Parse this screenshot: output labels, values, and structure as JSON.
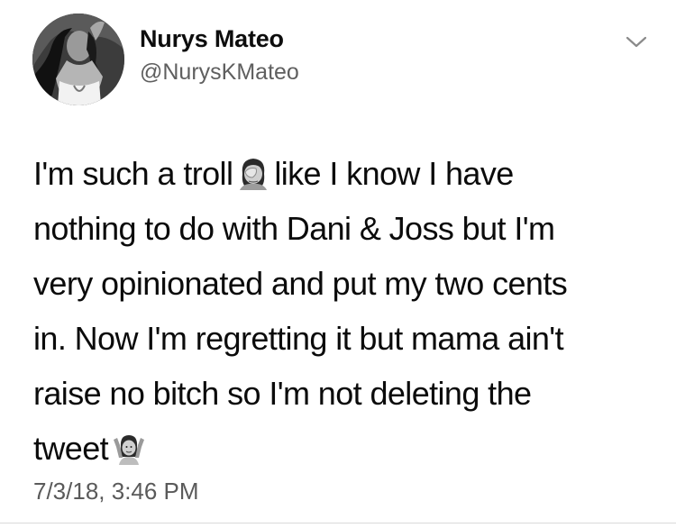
{
  "author": {
    "display_name": "Nurys Mateo",
    "handle": "@NurysKMateo",
    "avatar_icon": "profile-photo"
  },
  "tweet": {
    "lines": [
      {
        "before": "I'm such a troll",
        "emoji": "woman-facepalming-emoji",
        "after": "like I know I have"
      },
      {
        "text": "nothing to do with Dani & Joss but I'm"
      },
      {
        "text": "very opinionated and put my two cents"
      },
      {
        "text": "in. Now I'm regretting it but mama ain't"
      },
      {
        "text": "raise no bitch so I'm not deleting the"
      },
      {
        "before": "tweet",
        "emoji": "woman-shrugging-emoji",
        "after": ""
      }
    ],
    "timestamp": "7/3/18, 3:46 PM"
  },
  "icons": {
    "menu": "chevron-down-icon"
  },
  "colors": {
    "text": "#0b0b0b",
    "secondary": "#5f5f5f",
    "background": "#ffffff"
  }
}
